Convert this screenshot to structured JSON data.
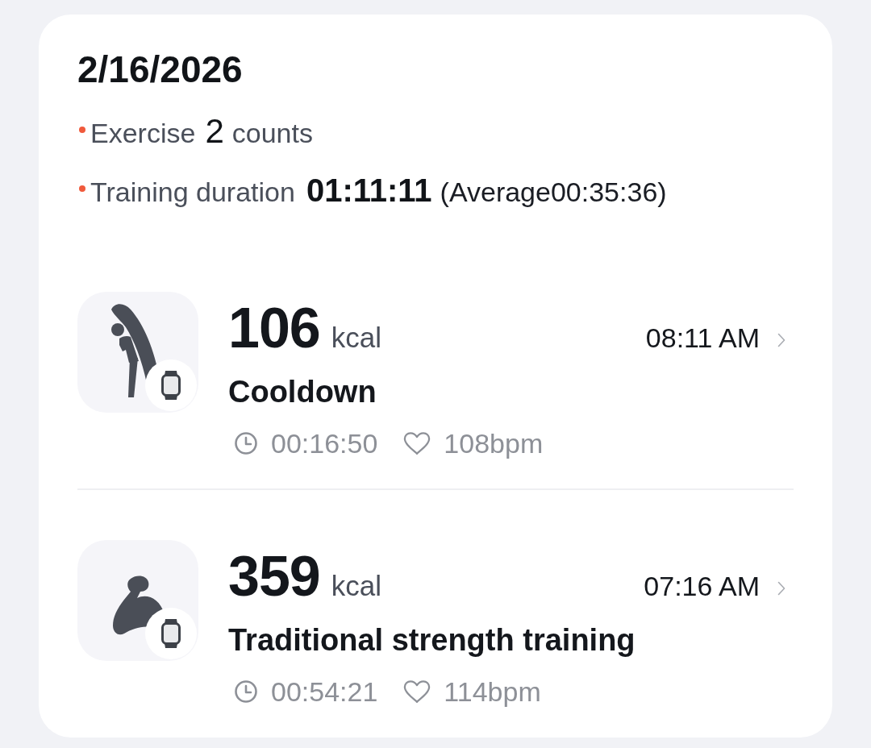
{
  "date": "2/16/2026",
  "summary": [
    {
      "label": "Exercise",
      "value": "2",
      "unit": "counts"
    },
    {
      "label": "Training duration",
      "value": "01:11:11",
      "note": "(Average00:35:36)"
    }
  ],
  "sessions": [
    {
      "kind": "stretch",
      "calories": "106",
      "unit": "kcal",
      "time": "08:11 AM",
      "name": "Cooldown",
      "duration": "00:16:50",
      "heart_rate": "108bpm"
    },
    {
      "kind": "strength",
      "calories": "359",
      "unit": "kcal",
      "time": "07:16 AM",
      "name": "Traditional strength training",
      "duration": "00:54:21",
      "heart_rate": "114bpm"
    }
  ]
}
